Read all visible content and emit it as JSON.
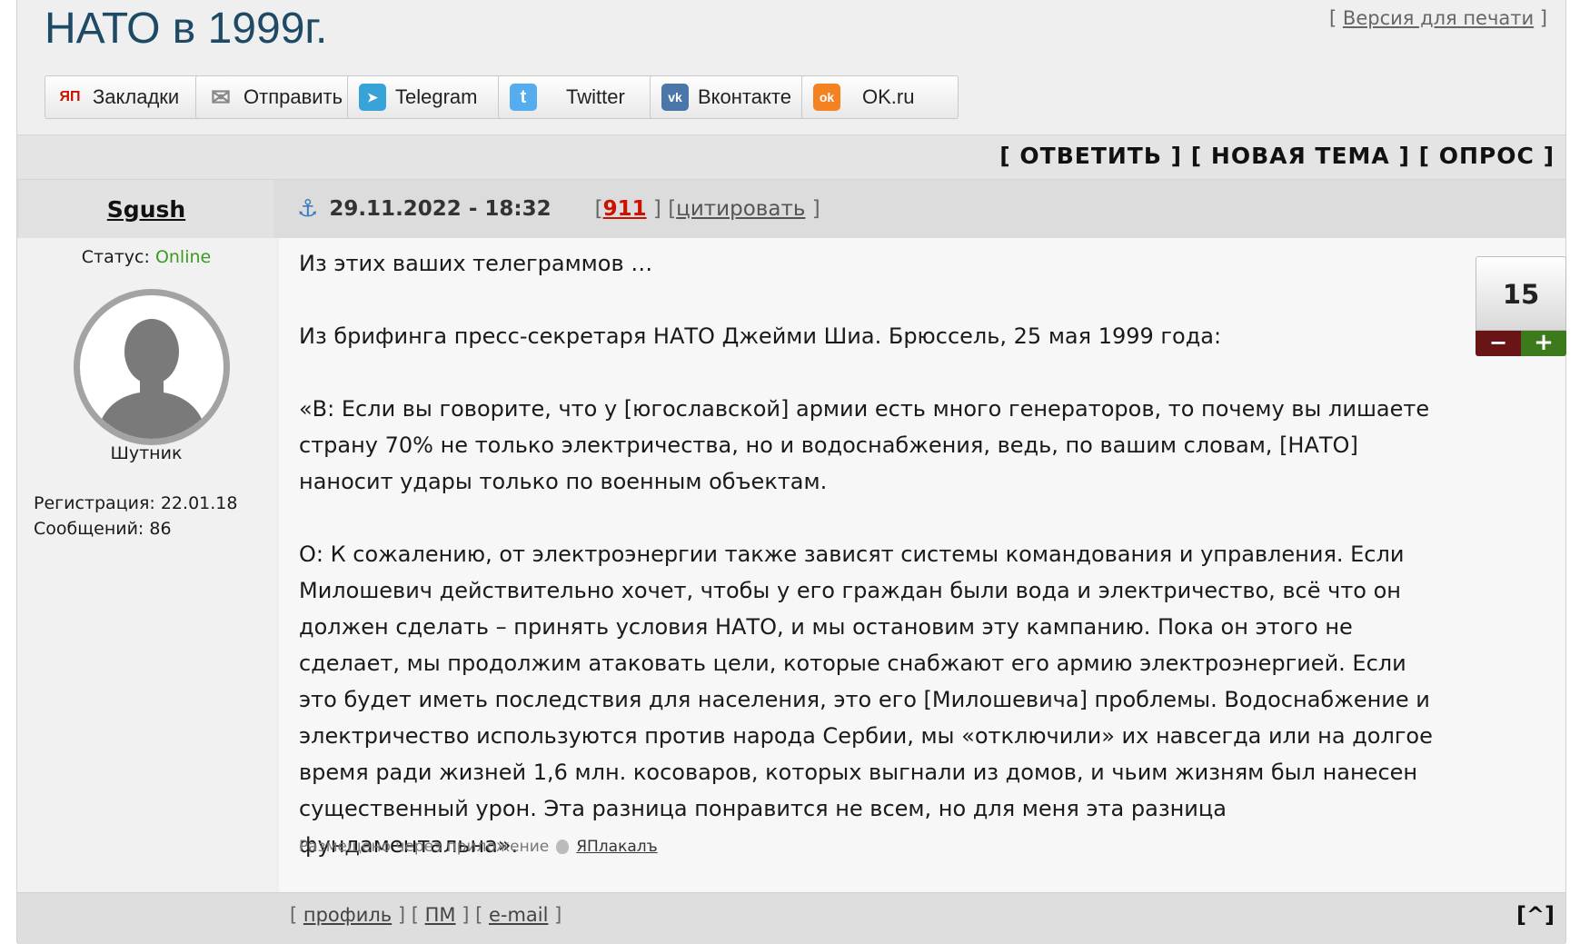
{
  "topic": {
    "title": "НАТО в 1999г.",
    "print_version": "Версия для печати"
  },
  "share": [
    {
      "id": "bookmarks",
      "label": "Закладки",
      "icon_text": "ЯП",
      "color": "#cc1100"
    },
    {
      "id": "send",
      "label": "Отправить",
      "icon_text": "✉",
      "color": "#888888"
    },
    {
      "id": "telegram",
      "label": "Telegram",
      "icon_text": "➤",
      "color": "#37a3d9"
    },
    {
      "id": "twitter",
      "label": "Twitter",
      "icon_text": "t",
      "color": "#55acee"
    },
    {
      "id": "vk",
      "label": "Вконтакте",
      "icon_text": "vk",
      "color": "#4a76a8"
    },
    {
      "id": "ok",
      "label": "OK.ru",
      "icon_text": "ok",
      "color": "#f58220"
    }
  ],
  "actions": {
    "reply": "ОТВЕТИТЬ",
    "new_topic": "НОВАЯ ТЕМА",
    "poll": "ОПРОС"
  },
  "post": {
    "author": "Sgush",
    "status_label": "Статус:",
    "status_value": "Online",
    "rank": "Шутник",
    "registration": "Регистрация: 22.01.18",
    "messages": "Сообщений: 86",
    "date": "29.11.2022 - 18:32",
    "number": "911",
    "quote": "цитировать",
    "paragraphs": [
      "Из этих ваших телеграммов …",
      "Из брифинга пресс-секретаря НАТО Джейми Шиа. Брюссель, 25 мая 1999 года:",
      "«В: Если вы говорите, что у [югославской] армии есть много генераторов, то почему вы лишаете страну 70% не только электричества, но и водоснабжения, ведь, по вашим словам, [НАТО] наносит удары только по военным объектам.",
      "О: К сожалению, от электроэнергии также зависят системы командования и управления. Если Милошевич действительно хочет, чтобы у его граждан были вода и электричество, всё что он должен сделать – принять условия НАТО, и мы остановим эту кампанию. Пока он этого не сделает, мы продолжим атаковать цели, которые снабжают его армию электроэнергией. Если это будет иметь последствия для населения, это его [Милошевича] проблемы. Водоснабжение и электричество используются против народа Сербии, мы «отключили» их навсегда или на долгое время ради жизней 1,6 млн. косоваров, которых выгнали из домов, и чьим жизням был нанесен существенный урон. Эта разница понравится не всем, но для меня эта разница фундаментальна»."
    ],
    "rating": "15",
    "rate_minus": "−",
    "rate_plus": "+",
    "posted_via": "Размещено через приложение",
    "app_name": "ЯПлакалъ"
  },
  "footer": {
    "profile": "профиль",
    "pm": "ПМ",
    "email": "e-mail",
    "to_top": "[^]"
  }
}
